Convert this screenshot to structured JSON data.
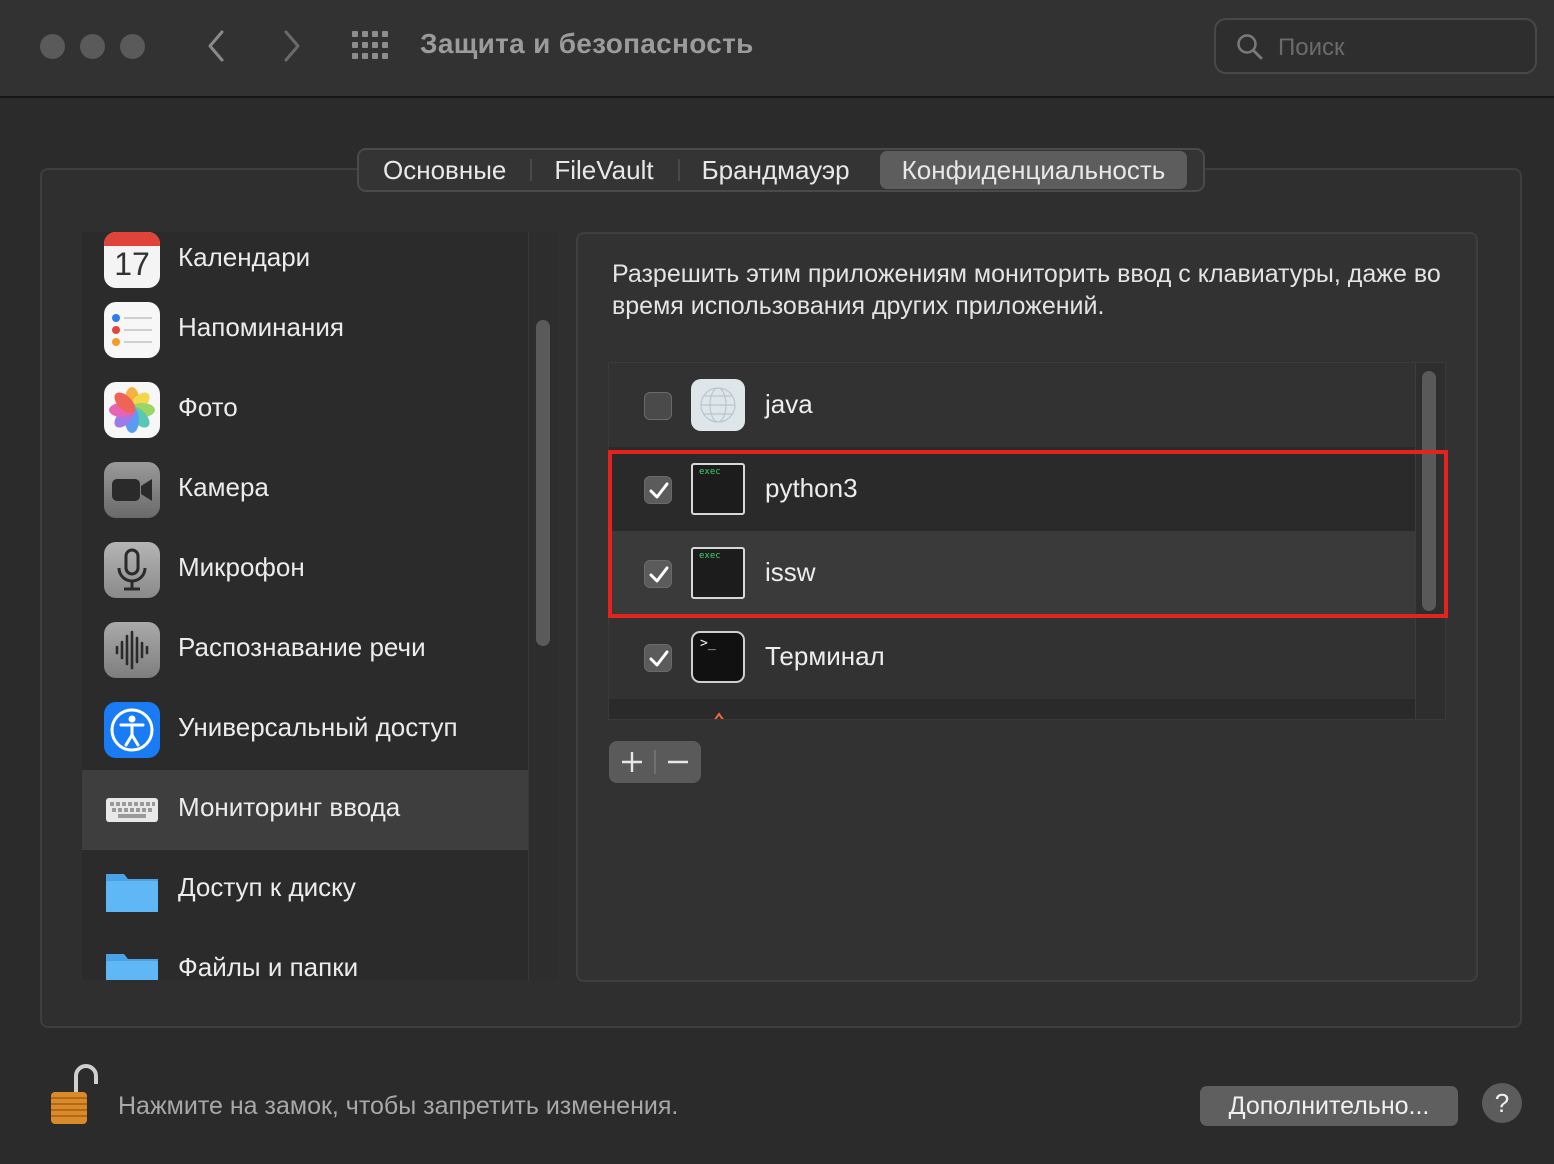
{
  "window": {
    "title": "Защита и безопасность",
    "search_placeholder": "Поиск"
  },
  "tabs": [
    {
      "label": "Основные",
      "active": false
    },
    {
      "label": "FileVault",
      "active": false
    },
    {
      "label": "Брандмауэр",
      "active": false
    },
    {
      "label": "Конфиденциальность",
      "active": true
    }
  ],
  "sidebar": {
    "items": [
      {
        "label": "Календари",
        "icon": "calendar-icon",
        "icon_text": "17"
      },
      {
        "label": "Напоминания",
        "icon": "reminders-icon"
      },
      {
        "label": "Фото",
        "icon": "photos-icon"
      },
      {
        "label": "Камера",
        "icon": "camera-icon"
      },
      {
        "label": "Микрофон",
        "icon": "microphone-icon"
      },
      {
        "label": "Распознавание речи",
        "icon": "speech-recognition-icon"
      },
      {
        "label": "Универсальный доступ",
        "icon": "accessibility-icon"
      },
      {
        "label": "Мониторинг ввода",
        "icon": "keyboard-icon",
        "selected": true
      },
      {
        "label": "Доступ к диску",
        "icon": "folder-icon"
      },
      {
        "label": "Файлы и папки",
        "icon": "folder-icon"
      }
    ]
  },
  "content": {
    "description": "Разрешить этим приложениям мониторить ввод с клавиатуры, даже во время использования других приложений.",
    "apps": [
      {
        "name": "java",
        "checked": false,
        "icon": "java-icon"
      },
      {
        "name": "python3",
        "checked": true,
        "icon": "exec-icon",
        "icon_text": "exec"
      },
      {
        "name": "issw",
        "checked": true,
        "icon": "exec-icon",
        "icon_text": "exec"
      },
      {
        "name": "Терминал",
        "checked": true,
        "icon": "terminal-icon",
        "icon_text": ">_"
      }
    ],
    "add_label": "+",
    "remove_label": "−"
  },
  "footer": {
    "lock_text": "Нажмите на замок, чтобы запретить изменения.",
    "advanced_label": "Дополнительно...",
    "help_label": "?"
  },
  "colors": {
    "highlight": "#e3231e",
    "accessibility_blue": "#1a7cf5",
    "folder_blue": "#5fb8f5"
  }
}
